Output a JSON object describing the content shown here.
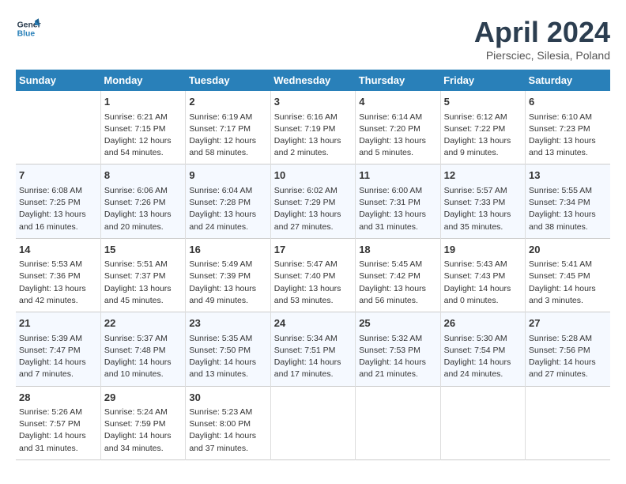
{
  "header": {
    "logo_line1": "General",
    "logo_line2": "Blue",
    "month": "April 2024",
    "location": "Piersciec, Silesia, Poland"
  },
  "weekdays": [
    "Sunday",
    "Monday",
    "Tuesday",
    "Wednesday",
    "Thursday",
    "Friday",
    "Saturday"
  ],
  "weeks": [
    [
      {
        "day": "",
        "text": ""
      },
      {
        "day": "1",
        "text": "Sunrise: 6:21 AM\nSunset: 7:15 PM\nDaylight: 12 hours\nand 54 minutes."
      },
      {
        "day": "2",
        "text": "Sunrise: 6:19 AM\nSunset: 7:17 PM\nDaylight: 12 hours\nand 58 minutes."
      },
      {
        "day": "3",
        "text": "Sunrise: 6:16 AM\nSunset: 7:19 PM\nDaylight: 13 hours\nand 2 minutes."
      },
      {
        "day": "4",
        "text": "Sunrise: 6:14 AM\nSunset: 7:20 PM\nDaylight: 13 hours\nand 5 minutes."
      },
      {
        "day": "5",
        "text": "Sunrise: 6:12 AM\nSunset: 7:22 PM\nDaylight: 13 hours\nand 9 minutes."
      },
      {
        "day": "6",
        "text": "Sunrise: 6:10 AM\nSunset: 7:23 PM\nDaylight: 13 hours\nand 13 minutes."
      }
    ],
    [
      {
        "day": "7",
        "text": "Sunrise: 6:08 AM\nSunset: 7:25 PM\nDaylight: 13 hours\nand 16 minutes."
      },
      {
        "day": "8",
        "text": "Sunrise: 6:06 AM\nSunset: 7:26 PM\nDaylight: 13 hours\nand 20 minutes."
      },
      {
        "day": "9",
        "text": "Sunrise: 6:04 AM\nSunset: 7:28 PM\nDaylight: 13 hours\nand 24 minutes."
      },
      {
        "day": "10",
        "text": "Sunrise: 6:02 AM\nSunset: 7:29 PM\nDaylight: 13 hours\nand 27 minutes."
      },
      {
        "day": "11",
        "text": "Sunrise: 6:00 AM\nSunset: 7:31 PM\nDaylight: 13 hours\nand 31 minutes."
      },
      {
        "day": "12",
        "text": "Sunrise: 5:57 AM\nSunset: 7:33 PM\nDaylight: 13 hours\nand 35 minutes."
      },
      {
        "day": "13",
        "text": "Sunrise: 5:55 AM\nSunset: 7:34 PM\nDaylight: 13 hours\nand 38 minutes."
      }
    ],
    [
      {
        "day": "14",
        "text": "Sunrise: 5:53 AM\nSunset: 7:36 PM\nDaylight: 13 hours\nand 42 minutes."
      },
      {
        "day": "15",
        "text": "Sunrise: 5:51 AM\nSunset: 7:37 PM\nDaylight: 13 hours\nand 45 minutes."
      },
      {
        "day": "16",
        "text": "Sunrise: 5:49 AM\nSunset: 7:39 PM\nDaylight: 13 hours\nand 49 minutes."
      },
      {
        "day": "17",
        "text": "Sunrise: 5:47 AM\nSunset: 7:40 PM\nDaylight: 13 hours\nand 53 minutes."
      },
      {
        "day": "18",
        "text": "Sunrise: 5:45 AM\nSunset: 7:42 PM\nDaylight: 13 hours\nand 56 minutes."
      },
      {
        "day": "19",
        "text": "Sunrise: 5:43 AM\nSunset: 7:43 PM\nDaylight: 14 hours\nand 0 minutes."
      },
      {
        "day": "20",
        "text": "Sunrise: 5:41 AM\nSunset: 7:45 PM\nDaylight: 14 hours\nand 3 minutes."
      }
    ],
    [
      {
        "day": "21",
        "text": "Sunrise: 5:39 AM\nSunset: 7:47 PM\nDaylight: 14 hours\nand 7 minutes."
      },
      {
        "day": "22",
        "text": "Sunrise: 5:37 AM\nSunset: 7:48 PM\nDaylight: 14 hours\nand 10 minutes."
      },
      {
        "day": "23",
        "text": "Sunrise: 5:35 AM\nSunset: 7:50 PM\nDaylight: 14 hours\nand 13 minutes."
      },
      {
        "day": "24",
        "text": "Sunrise: 5:34 AM\nSunset: 7:51 PM\nDaylight: 14 hours\nand 17 minutes."
      },
      {
        "day": "25",
        "text": "Sunrise: 5:32 AM\nSunset: 7:53 PM\nDaylight: 14 hours\nand 21 minutes."
      },
      {
        "day": "26",
        "text": "Sunrise: 5:30 AM\nSunset: 7:54 PM\nDaylight: 14 hours\nand 24 minutes."
      },
      {
        "day": "27",
        "text": "Sunrise: 5:28 AM\nSunset: 7:56 PM\nDaylight: 14 hours\nand 27 minutes."
      }
    ],
    [
      {
        "day": "28",
        "text": "Sunrise: 5:26 AM\nSunset: 7:57 PM\nDaylight: 14 hours\nand 31 minutes."
      },
      {
        "day": "29",
        "text": "Sunrise: 5:24 AM\nSunset: 7:59 PM\nDaylight: 14 hours\nand 34 minutes."
      },
      {
        "day": "30",
        "text": "Sunrise: 5:23 AM\nSunset: 8:00 PM\nDaylight: 14 hours\nand 37 minutes."
      },
      {
        "day": "",
        "text": ""
      },
      {
        "day": "",
        "text": ""
      },
      {
        "day": "",
        "text": ""
      },
      {
        "day": "",
        "text": ""
      }
    ]
  ]
}
